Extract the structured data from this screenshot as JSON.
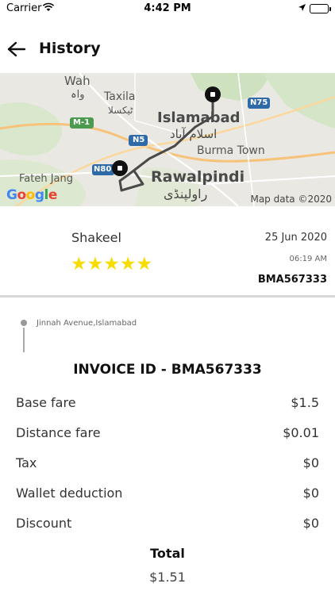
{
  "status_bar": {
    "carrier": "Carrier",
    "time": "4:42 PM"
  },
  "header": {
    "title": "History"
  },
  "map": {
    "labels": {
      "wah": "Wah",
      "wah_urdu": "واہ",
      "taxila": "Taxila",
      "taxila_urdu": "ٹیکسلا",
      "islamabad": "Islamabad",
      "islamabad_urdu": "اسلام آباد",
      "burma_town": "Burma Town",
      "fateh_jang": "Fateh Jang",
      "rawalpindi": "Rawalpindi",
      "rawalpindi_urdu": "راولپنڈی",
      "m1": "M-1",
      "n5": "N5",
      "n75": "N75",
      "n80": "N80"
    },
    "google": "Google",
    "credit": "Map data ©2020"
  },
  "driver": {
    "name": "Shakeel",
    "rating": 5,
    "stars": "★★★★★",
    "date": "25 Jun 2020",
    "time": "06:19 AM",
    "code": "BMA567333"
  },
  "route": {
    "address": "Jinnah Avenue,Islamabad"
  },
  "invoice": {
    "title": "INVOICE ID - BMA567333",
    "rows": [
      {
        "label": "Base fare",
        "value": "$1.5"
      },
      {
        "label": "Distance fare",
        "value": "$0.01"
      },
      {
        "label": "Tax",
        "value": "$0"
      },
      {
        "label": "Wallet deduction",
        "value": "$0"
      },
      {
        "label": "Discount",
        "value": "$0"
      }
    ],
    "total_label": "Total",
    "total_value": "$1.51"
  },
  "colors": {
    "star": "#f7dc00",
    "route": "#555555",
    "marker": "#111111"
  }
}
